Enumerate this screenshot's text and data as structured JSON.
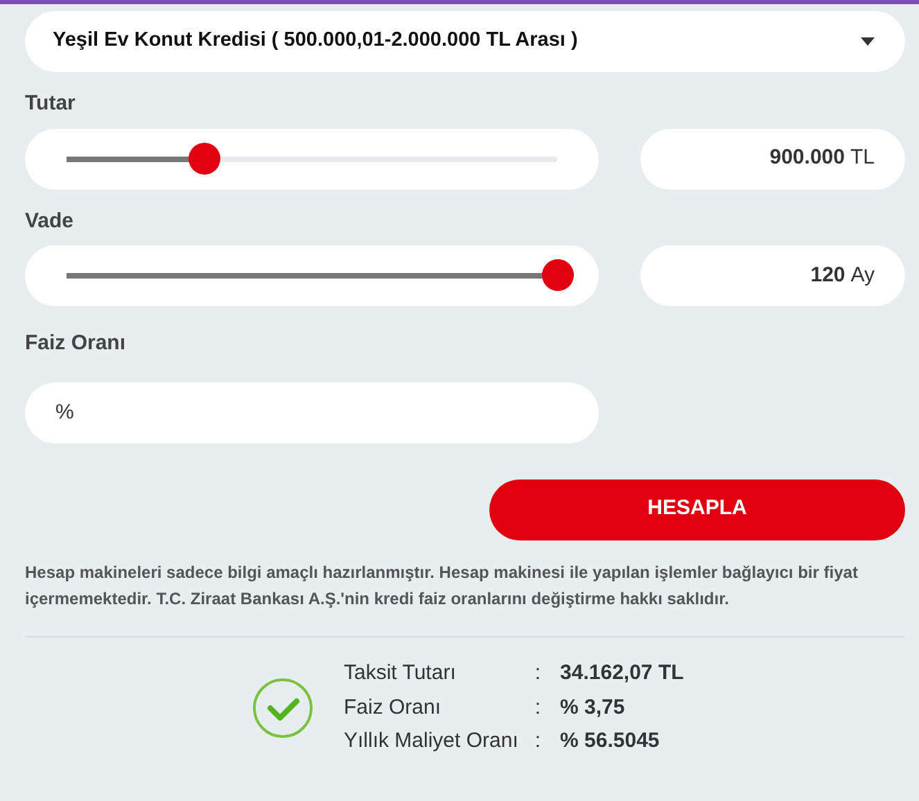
{
  "loan_type": {
    "value": "Yeşil Ev Konut Kredisi ( 500.000,01-2.000.000 TL Arası )"
  },
  "sliders": [
    {
      "label": "Tutar",
      "level": 0.28,
      "value": "900.000",
      "unit": "TL"
    },
    {
      "label": "Vade",
      "level": 1.0,
      "value": "120",
      "unit": "Ay"
    }
  ],
  "rate_field": {
    "label": "Faiz Oranı",
    "placeholder": "%"
  },
  "calculate_button": "HESAPLA",
  "disclaimer": "Hesap makineleri sadece bilgi amaçlı hazırlanmıştır. Hesap makinesi ile yapılan işlemler bağlayıcı bir fiyat içermemektedir. T.C. Ziraat Bankası A.Ş.'nin kredi faiz oranlarını değiştirme hakkı saklıdır.",
  "results": [
    {
      "label": "Taksit Tutarı",
      "separator": ":",
      "value": "34.162,07 TL"
    },
    {
      "label": "Faiz Oranı",
      "separator": ":",
      "value": "% 3,75"
    },
    {
      "label": "Yıllık Maliyet Oranı",
      "separator": ":",
      "value": "% 56.5045"
    }
  ]
}
